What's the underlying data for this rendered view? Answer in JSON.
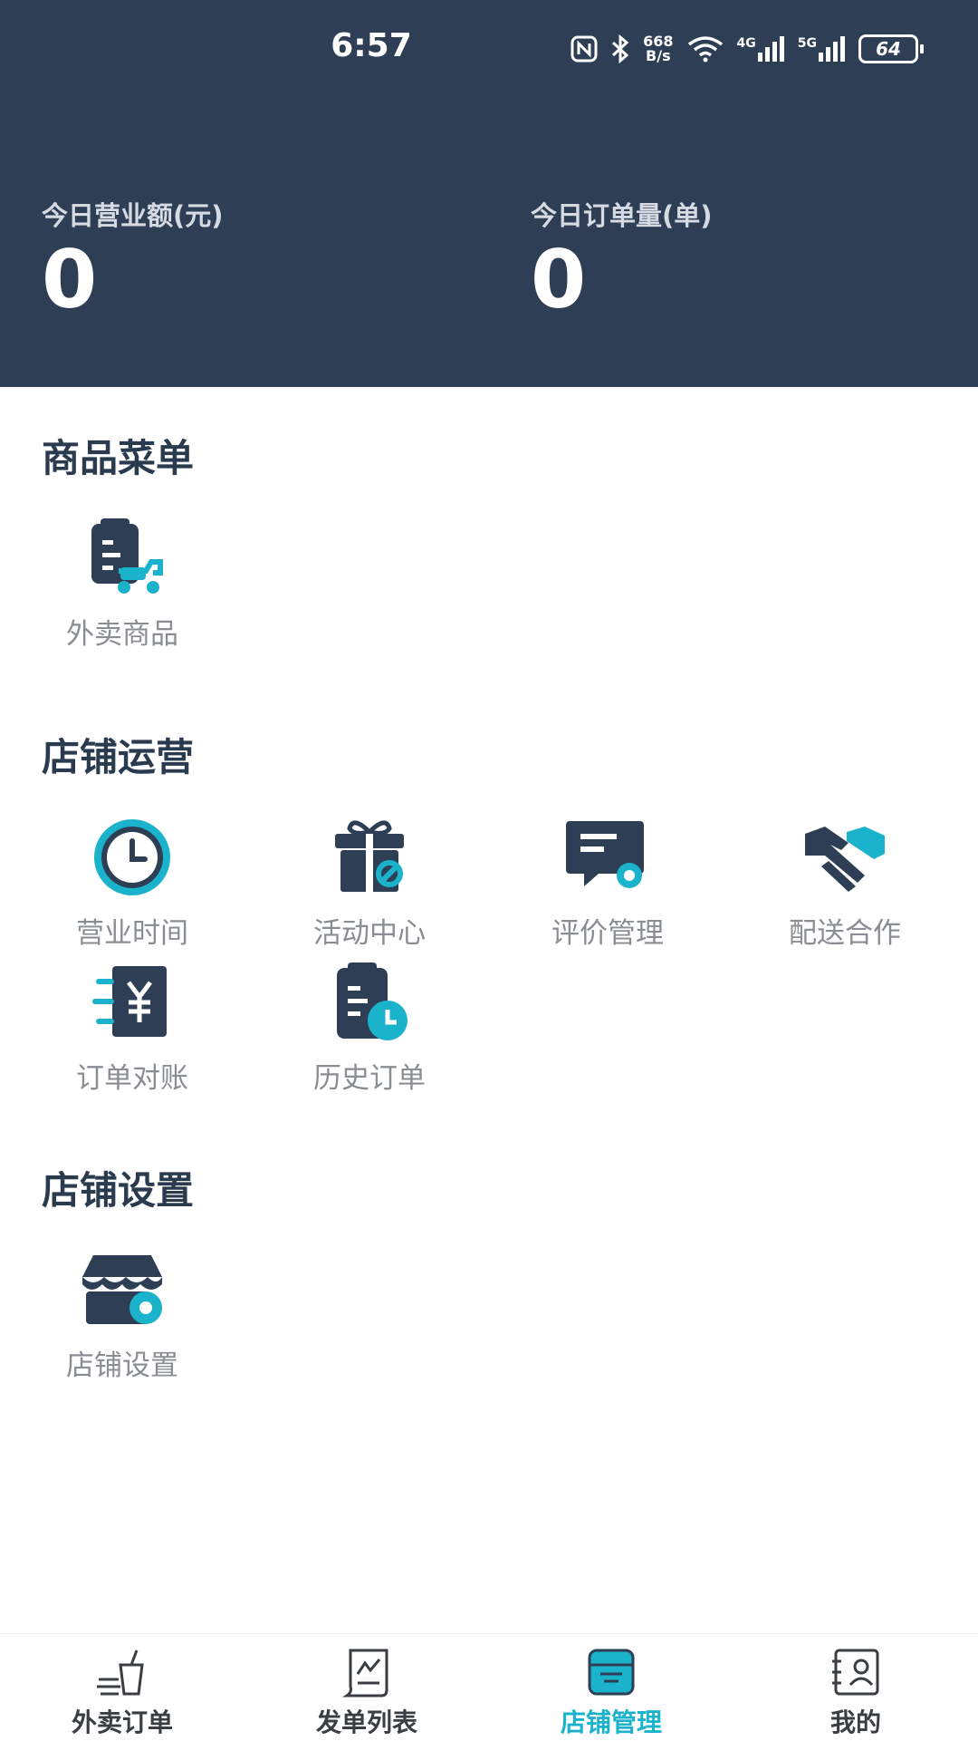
{
  "status_bar": {
    "time": "6:57",
    "net_speed_top": "668",
    "net_speed_bottom": "B/s",
    "signal_4g": "4G",
    "signal_5g": "5G",
    "battery": "64",
    "icons": [
      "nfc-icon",
      "bluetooth-icon",
      "wifi-icon",
      "signal-icon",
      "battery-icon"
    ]
  },
  "stats": {
    "revenue_label": "今日营业额(元)",
    "revenue_value": "0",
    "orders_label": "今日订单量(单)",
    "orders_value": "0"
  },
  "sections": {
    "menu_title": "商品菜单",
    "menu_items": [
      {
        "label": "外卖商品",
        "icon": "takeout-goods-icon"
      }
    ],
    "ops_title": "店铺运营",
    "ops_items": [
      {
        "label": "营业时间",
        "icon": "clock-icon"
      },
      {
        "label": "活动中心",
        "icon": "gift-icon"
      },
      {
        "label": "评价管理",
        "icon": "review-icon"
      },
      {
        "label": "配送合作",
        "icon": "handshake-icon"
      },
      {
        "label": "订单对账",
        "icon": "yuan-ledger-icon"
      },
      {
        "label": "历史订单",
        "icon": "history-clipboard-icon"
      }
    ],
    "settings_title": "店铺设置",
    "settings_items": [
      {
        "label": "店铺设置",
        "icon": "store-settings-icon"
      }
    ]
  },
  "tabbar": {
    "tabs": [
      {
        "label": "外卖订单",
        "icon": "takeout-order-icon"
      },
      {
        "label": "发单列表",
        "icon": "dispatch-list-icon"
      },
      {
        "label": "店铺管理",
        "icon": "store-manage-icon"
      },
      {
        "label": "我的",
        "icon": "profile-icon"
      }
    ],
    "active_index": 2
  },
  "colors": {
    "header_bg": "#2e3e54",
    "icon_dark": "#2e3e54",
    "icon_accent": "#1bb3cc",
    "label_gray": "#8a8d92"
  }
}
